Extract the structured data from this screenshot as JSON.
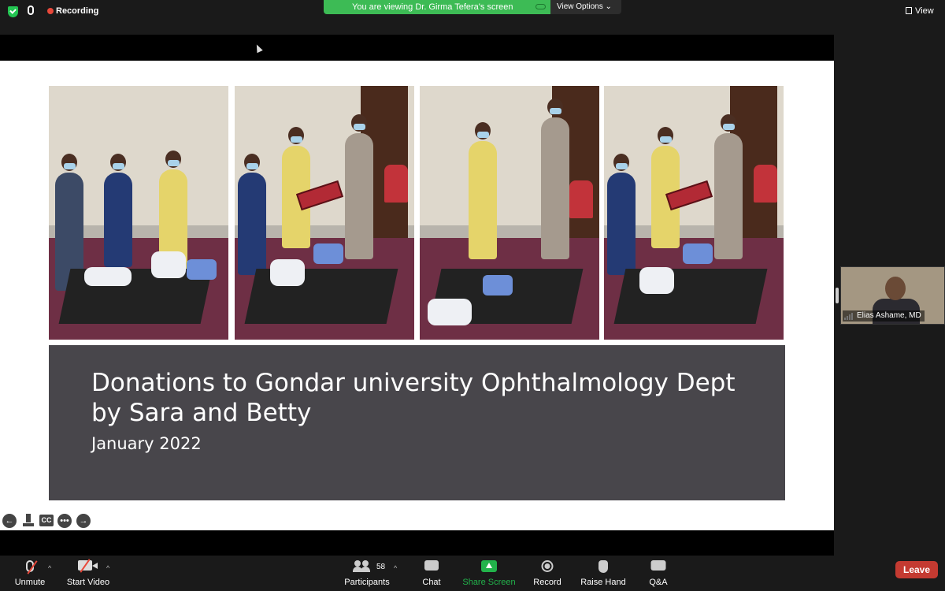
{
  "top_bar": {
    "recording_label": "Recording",
    "viewing_banner": "You are viewing Dr. Girma Tefera's screen",
    "view_options_label": "View Options",
    "view_label": "View"
  },
  "slide": {
    "title_line1": "Donations to Gondar university Ophthalmology Dept",
    "title_line2": "by Sara and Betty",
    "date": "January 2022",
    "controls": {
      "cc_label": "CC"
    }
  },
  "participant_tile": {
    "name": "Elias Ashame, MD"
  },
  "toolbar": {
    "unmute_label": "Unmute",
    "start_video_label": "Start Video",
    "participants_label": "Participants",
    "participants_count": "58",
    "chat_label": "Chat",
    "share_screen_label": "Share Screen",
    "record_label": "Record",
    "raise_hand_label": "Raise Hand",
    "qa_label": "Q&A",
    "leave_label": "Leave"
  },
  "colors": {
    "share_green": "#22b34b",
    "banner_green": "#3dbb55",
    "leave_red": "#c43a31",
    "title_box": "#48464b"
  }
}
